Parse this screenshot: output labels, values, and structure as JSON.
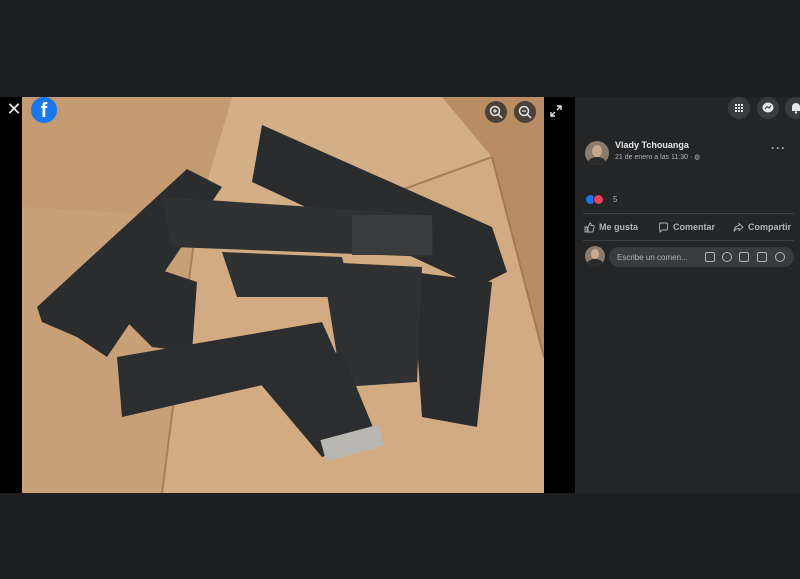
{
  "viewer": {
    "close_icon": "close-icon",
    "logo_icon": "facebook-logo",
    "logo_letter": "f",
    "zoom_in_icon": "zoom-in-icon",
    "zoom_out_icon": "zoom-out-icon",
    "fullscreen_icon": "expand-icon"
  },
  "header_icons": [
    "grid-menu-icon",
    "messenger-icon",
    "notifications-icon"
  ],
  "post": {
    "author": "Vlady Tchouanga",
    "date": "21 de enero a las 11:30 ·",
    "more_label": "···",
    "reaction_count": "5",
    "reactions": [
      "like",
      "love"
    ]
  },
  "actions": {
    "like": "Me gusta",
    "comment": "Comentar",
    "share": "Compartir"
  },
  "comment_box": {
    "placeholder": "Escribe un comen...",
    "icons": [
      "sticker-icon",
      "emoji-icon",
      "camera-icon",
      "gif-icon",
      "sticker-alt-icon"
    ]
  },
  "colors": {
    "background": "#1e1f21",
    "panel": "#242526",
    "accent": "#1877f2",
    "love": "#f33e58",
    "text": "#e4e6eb",
    "muted": "#b0b3b8"
  }
}
